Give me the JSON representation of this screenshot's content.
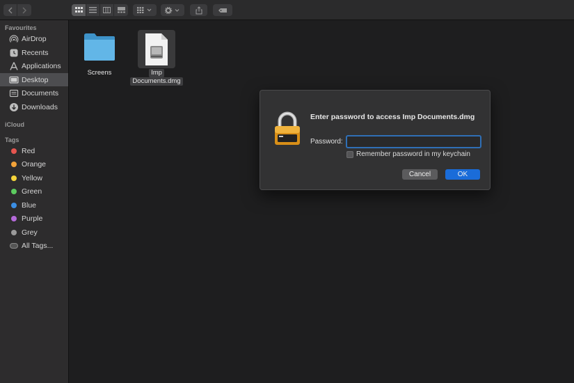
{
  "sidebar": {
    "favourites_heading": "Favourites",
    "favourites": [
      {
        "label": "AirDrop",
        "icon": "airdrop-icon"
      },
      {
        "label": "Recents",
        "icon": "clock-icon"
      },
      {
        "label": "Applications",
        "icon": "applications-icon"
      },
      {
        "label": "Desktop",
        "icon": "desktop-icon",
        "selected": true
      },
      {
        "label": "Documents",
        "icon": "document-icon"
      },
      {
        "label": "Downloads",
        "icon": "download-icon"
      }
    ],
    "icloud_heading": "iCloud",
    "tags_heading": "Tags",
    "tags": [
      {
        "label": "Red",
        "color": "#e5554f"
      },
      {
        "label": "Orange",
        "color": "#f2a33a"
      },
      {
        "label": "Yellow",
        "color": "#f5d43b"
      },
      {
        "label": "Green",
        "color": "#5ccb5f"
      },
      {
        "label": "Blue",
        "color": "#3b8fe5"
      },
      {
        "label": "Purple",
        "color": "#b46ad9"
      },
      {
        "label": "Grey",
        "color": "#9a9a9a"
      }
    ],
    "all_tags_label": "All Tags..."
  },
  "files": [
    {
      "name": "Screens",
      "icon": "folder-icon"
    },
    {
      "name_line1": "Imp",
      "name_line2": "Documents.dmg",
      "icon": "dmg-file-icon",
      "selected": true
    }
  ],
  "dialog": {
    "title": "Enter password to access Imp Documents.dmg",
    "password_label": "Password:",
    "password_value": "",
    "remember_label": "Remember password in my keychain",
    "remember_checked": false,
    "cancel_label": "Cancel",
    "ok_label": "OK",
    "icon": "padlock-icon"
  }
}
